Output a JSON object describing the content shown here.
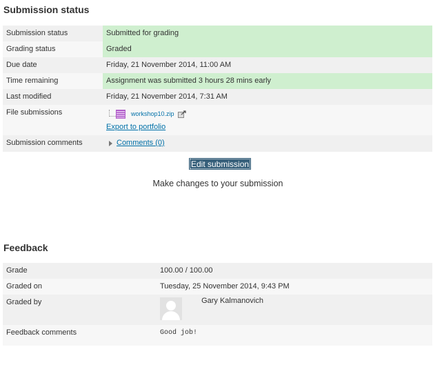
{
  "submission": {
    "title": "Submission status",
    "rows": [
      {
        "label": "Submission status",
        "value": "Submitted for grading"
      },
      {
        "label": "Grading status",
        "value": "Graded"
      },
      {
        "label": "Due date",
        "value": "Friday, 21 November 2014, 11:00 AM"
      },
      {
        "label": "Time remaining",
        "value": "Assignment was submitted 3 hours 28 mins early"
      },
      {
        "label": "Last modified",
        "value": "Friday, 21 November 2014, 7:31 AM"
      },
      {
        "label": "File submissions",
        "file_name": "workshop10.zip",
        "export_label": "Export to portfolio"
      },
      {
        "label": "Submission comments",
        "comments_label": "Comments (0)"
      }
    ],
    "edit_button": "Edit submission",
    "edit_description": "Make changes to your submission"
  },
  "feedback": {
    "title": "Feedback",
    "rows": [
      {
        "label": "Grade",
        "value": "100.00 / 100.00"
      },
      {
        "label": "Graded on",
        "value": "Tuesday, 25 November 2014, 9:43 PM"
      },
      {
        "label": "Graded by",
        "value": "Gary Kalmanovich"
      },
      {
        "label": "Feedback comments",
        "value": "Good job!"
      }
    ]
  },
  "icons": {
    "file": "zip-file-icon",
    "portfolio": "portfolio-export-icon",
    "toggle": "caret-right-icon",
    "avatar": "user-avatar-icon"
  },
  "colors": {
    "success_bg": "#cfefcf",
    "link": "#0070a8",
    "button_bg": "#365f7a"
  }
}
